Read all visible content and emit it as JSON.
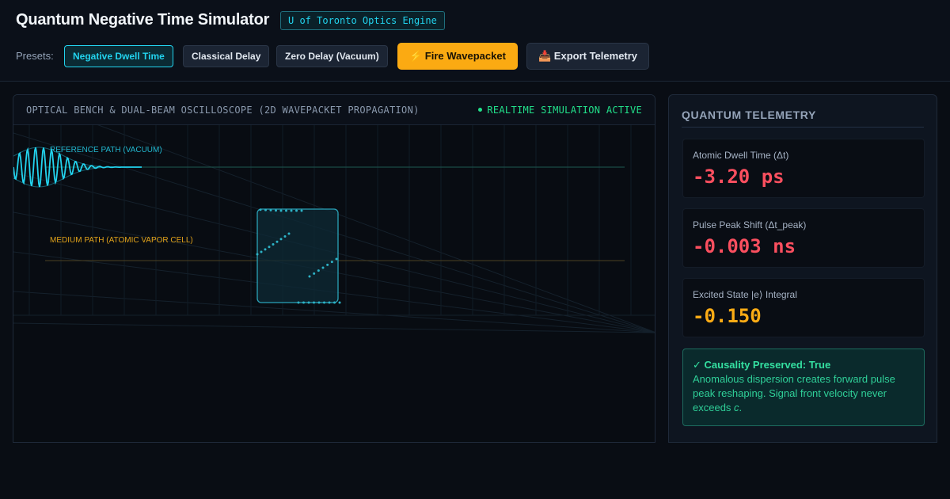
{
  "header": {
    "title": "Quantum Negative Time Simulator",
    "badge": "U of Toronto Optics Engine",
    "presets_label": "Presets:",
    "presets": [
      {
        "label": "Negative Dwell Time",
        "active": true
      },
      {
        "label": "Classical Delay",
        "active": false
      },
      {
        "label": "Zero Delay (Vacuum)",
        "active": false
      }
    ],
    "fire_label": "⚡ Fire Wavepacket",
    "export_label": "📥 Export Telemetry"
  },
  "bench": {
    "title": "OPTICAL BENCH & DUAL-BEAM OSCILLOSCOPE (2D WAVEPACKET PROPAGATION)",
    "status": "REALTIME SIMULATION ACTIVE",
    "reference_label": "REFERENCE PATH (VACUUM)",
    "medium_label": "MEDIUM PATH (ATOMIC VAPOR CELL)",
    "colors": {
      "reference": "#22d3ee",
      "medium": "#e0a21a",
      "cell": "#2aa3b8"
    }
  },
  "telemetry": {
    "title": "QUANTUM TELEMETRY",
    "dwell_label": "Atomic Dwell Time (Δt)",
    "dwell_value": "-3.20 ps",
    "peak_label": "Pulse Peak Shift (Δt_peak)",
    "peak_value": "-0.003 ns",
    "excited_label": "Excited State |e⟩ Integral",
    "excited_value": "-0.150",
    "causality_title": "✓ Causality Preserved: True",
    "causality_text_before": "Anomalous dispersion creates forward pulse peak reshaping. Signal front velocity never exceeds ",
    "causality_text_c": "c",
    "causality_text_after": "."
  }
}
